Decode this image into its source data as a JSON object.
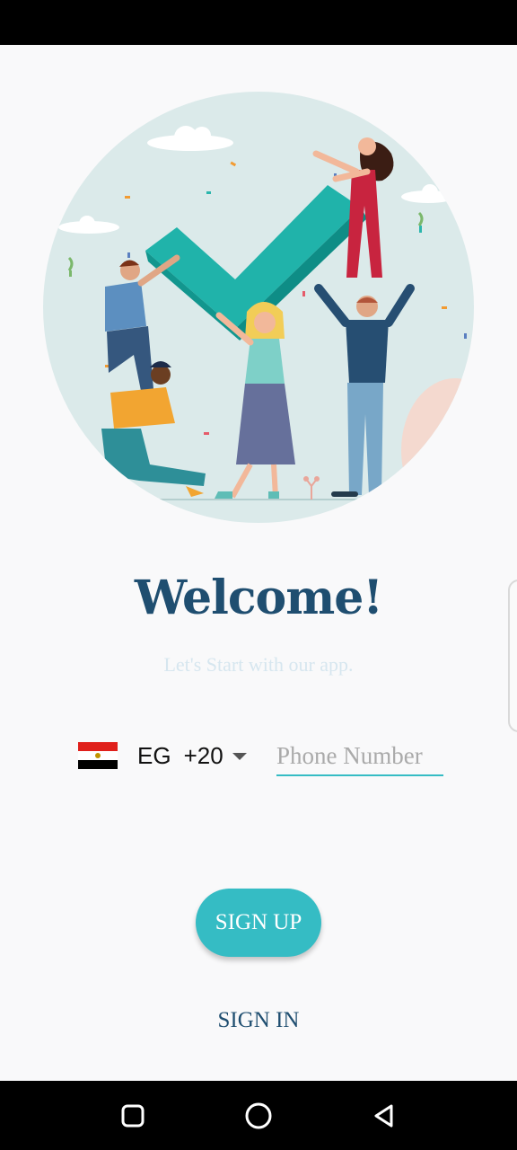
{
  "welcome": {
    "title": "Welcome!",
    "subtitle": "Let's Start with our app."
  },
  "phone": {
    "country_code": "EG",
    "dial_code": "+20",
    "flag_icon": "egypt-flag-icon",
    "placeholder": "Phone Number",
    "value": ""
  },
  "actions": {
    "signup_label": "SIGN UP",
    "signin_label": "SIGN IN"
  },
  "nav": {
    "icons": [
      "recent-apps-icon",
      "home-icon",
      "back-icon"
    ]
  },
  "colors": {
    "primary_dark": "#1f4e70",
    "accent_teal": "#35bcc4",
    "subtitle": "#d6e6ef",
    "hero_circle": "#dbeaea",
    "background": "#f9f9fa"
  }
}
